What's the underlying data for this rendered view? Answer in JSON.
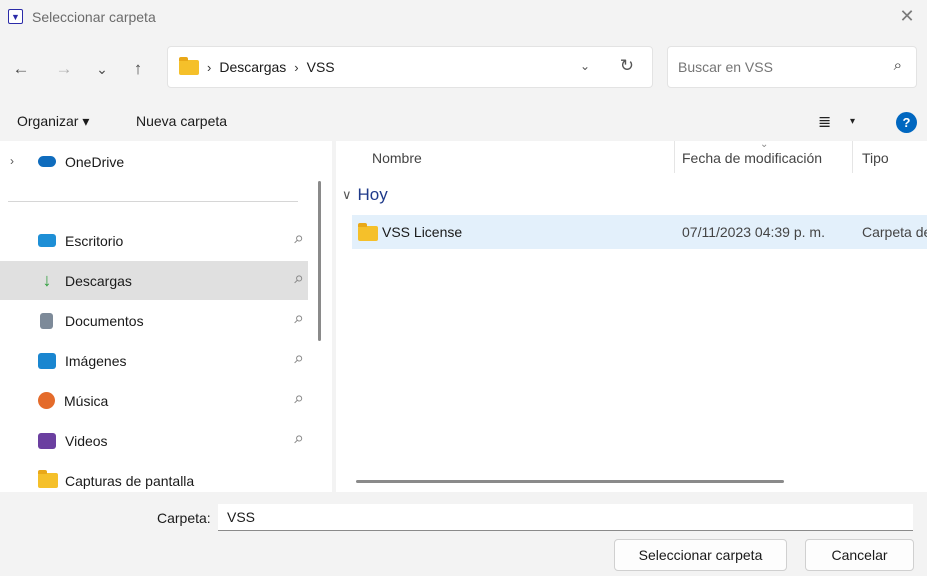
{
  "window": {
    "title": "Seleccionar carpeta",
    "app_icon_glyph": "▼",
    "close_glyph": "✕"
  },
  "nav": {
    "back_icon": "←",
    "forward_icon": "→",
    "recent_icon": "⌄",
    "up_icon": "↑",
    "breadcrumb": [
      "Descargas",
      "VSS"
    ],
    "crumb_separator": "›",
    "address_dropdown_icon": "⌄",
    "refresh_icon": "↻"
  },
  "search": {
    "placeholder": "Buscar en VSS",
    "icon": "⌕"
  },
  "toolbar": {
    "organize_label": "Organizar ▾",
    "new_folder_label": "Nueva carpeta",
    "view_icon": "≣",
    "view_caret": "▾",
    "help_icon": "?"
  },
  "sidebar": {
    "expand_icon": "›",
    "pin_glyph": "📌",
    "items": [
      {
        "label": "OneDrive",
        "icon": "cloud-icon",
        "color": "#0f6cbd"
      },
      {
        "label": "Escritorio",
        "icon": "desktop-icon",
        "color": "#1e8fd6"
      },
      {
        "label": "Descargas",
        "icon": "download-icon",
        "color": "#2b9d3a"
      },
      {
        "label": "Documentos",
        "icon": "document-icon",
        "color": "#7d8a99"
      },
      {
        "label": "Imágenes",
        "icon": "image-icon",
        "color": "#1a86d0"
      },
      {
        "label": "Música",
        "icon": "music-icon",
        "color": "#e46b2b"
      },
      {
        "label": "Videos",
        "icon": "video-icon",
        "color": "#6b3fa0"
      },
      {
        "label": "Capturas de pantalla",
        "icon": "folder-icon",
        "color": "#f5c02a"
      }
    ]
  },
  "file_list": {
    "columns": [
      "Nombre",
      "Fecha de modificación",
      "Tipo"
    ],
    "sort_indicator": "⌄",
    "group_label": "Hoy",
    "group_chevron": "∨",
    "rows": [
      {
        "name": "VSS License",
        "date": "07/11/2023 04:39 p. m.",
        "type": "Carpeta de"
      }
    ]
  },
  "bottom": {
    "folder_label": "Carpeta:",
    "folder_value": "VSS",
    "select_button": "Seleccionar carpeta",
    "cancel_button": "Cancelar"
  },
  "colors": {
    "accent": "#0067c0",
    "selection": "#e3f0fb",
    "sidebar_selected": "#e0e0e0"
  }
}
